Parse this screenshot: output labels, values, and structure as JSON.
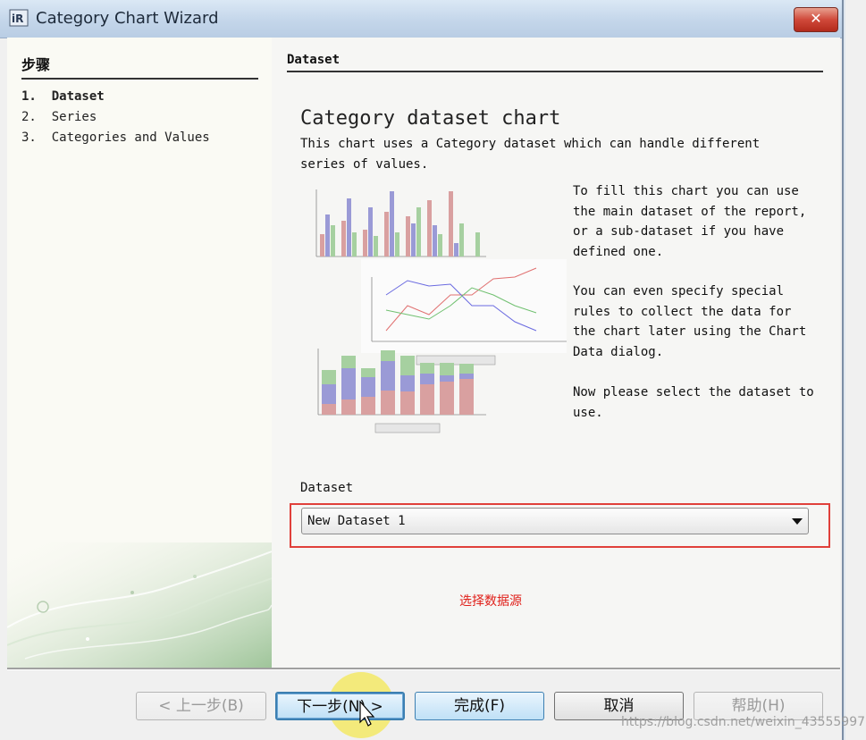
{
  "window": {
    "title": "Category Chart Wizard",
    "close_label": "✕"
  },
  "steps": {
    "title": "步骤",
    "items": [
      {
        "num": "1.",
        "label": "Dataset"
      },
      {
        "num": "2.",
        "label": "Series"
      },
      {
        "num": "3.",
        "label": "Categories and Values"
      }
    ]
  },
  "main": {
    "section_title": "Dataset",
    "heading": "Category dataset chart",
    "intro": "This chart uses a Category dataset which can handle different series of values.",
    "desc1": "To fill this chart you can use the main dataset of the report, or a sub-dataset if you have defined one.",
    "desc2": "You can even specify special rules to collect the data for the chart later using the Chart Data dialog.",
    "desc3": "Now please select the dataset to use.",
    "dataset_label": "Dataset",
    "dataset_value": "New Dataset 1",
    "annotation": "选择数据源"
  },
  "buttons": {
    "back": "< 上一步(B)",
    "next": "下一步(N) >",
    "finish": "完成(F)",
    "cancel": "取消",
    "help": "帮助(H)"
  },
  "watermark": "https://blog.csdn.net/weixin_43555997",
  "colors": {
    "annotation": "#e0201a",
    "highlight_border": "#e0403a"
  }
}
